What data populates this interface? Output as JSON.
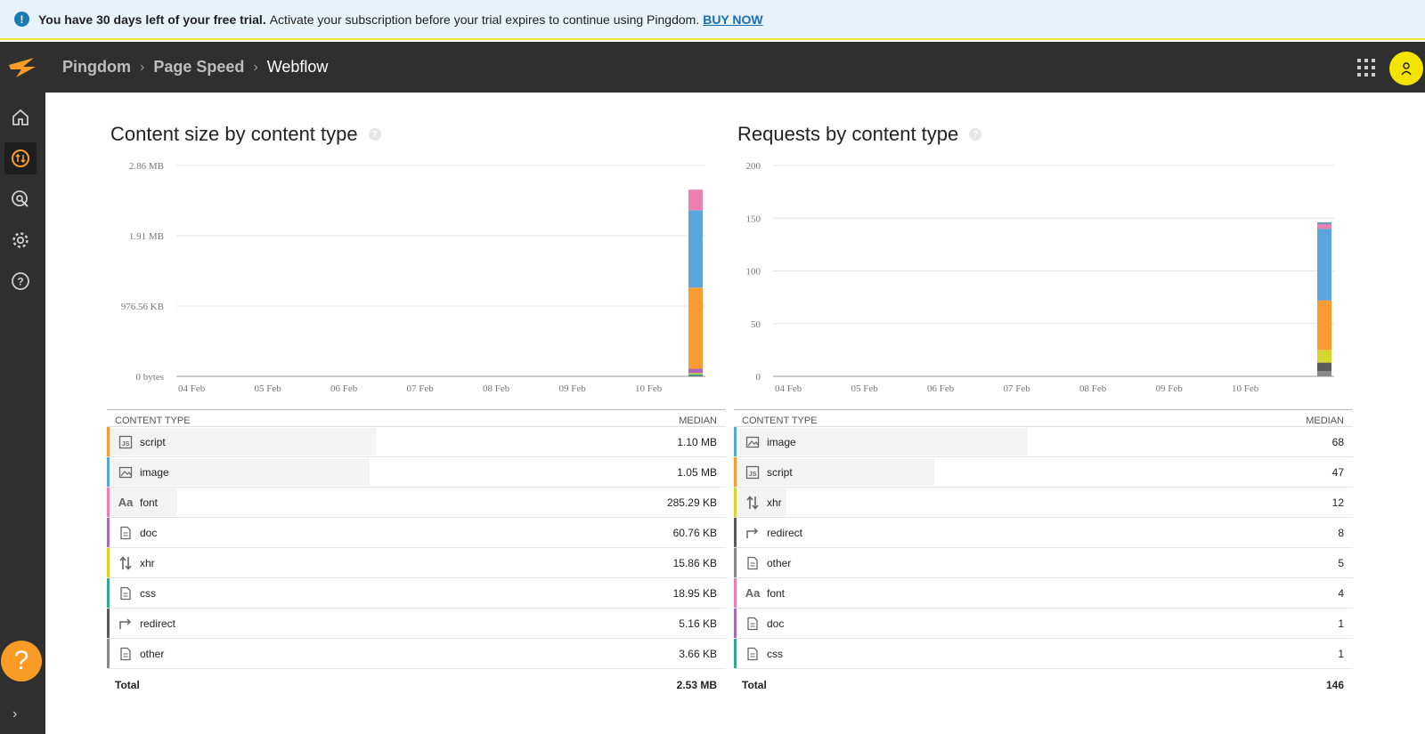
{
  "banner": {
    "bold_text": "You have 30 days left of your free trial.",
    "text": "Activate your subscription before your trial expires to continue using Pingdom.",
    "link": "BUY NOW"
  },
  "breadcrumb": [
    "Pingdom",
    "Page Speed",
    "Webflow"
  ],
  "colors": {
    "script": "#f99b32",
    "image": "#5aa5dc",
    "font": "#ec7fb0",
    "doc": "#a968b8",
    "xhr": "#d6d52f",
    "css": "#37a58e",
    "redirect": "#5b5b5b",
    "other": "#888888"
  },
  "chart_data": [
    {
      "type": "bar",
      "title": "Content size by content type",
      "x_ticks": [
        "04 Feb",
        "05 Feb",
        "06 Feb",
        "07 Feb",
        "08 Feb",
        "09 Feb",
        "10 Feb"
      ],
      "y_ticks": [
        "0 bytes",
        "976.56 KB",
        "1.91 MB",
        "2.86 MB"
      ],
      "ylim": [
        0,
        2.86
      ],
      "unit": "MB",
      "stacked": true,
      "series": [
        {
          "name": "other",
          "values": [
            0.004
          ]
        },
        {
          "name": "redirect",
          "values": [
            0.005
          ]
        },
        {
          "name": "css",
          "values": [
            0.019
          ]
        },
        {
          "name": "xhr",
          "values": [
            0.016
          ]
        },
        {
          "name": "doc",
          "values": [
            0.059
          ]
        },
        {
          "name": "script",
          "values": [
            1.1
          ]
        },
        {
          "name": "image",
          "values": [
            1.05
          ]
        },
        {
          "name": "font",
          "values": [
            0.279
          ]
        }
      ]
    },
    {
      "type": "bar",
      "title": "Requests by content type",
      "x_ticks": [
        "04 Feb",
        "05 Feb",
        "06 Feb",
        "07 Feb",
        "08 Feb",
        "09 Feb",
        "10 Feb"
      ],
      "y_ticks": [
        "0",
        "50",
        "100",
        "150",
        "200"
      ],
      "ylim": [
        0,
        200
      ],
      "stacked": true,
      "series": [
        {
          "name": "other",
          "values": [
            5
          ]
        },
        {
          "name": "redirect",
          "values": [
            8
          ]
        },
        {
          "name": "xhr",
          "values": [
            12
          ]
        },
        {
          "name": "script",
          "values": [
            47
          ]
        },
        {
          "name": "image",
          "values": [
            68
          ]
        },
        {
          "name": "font",
          "values": [
            4
          ]
        },
        {
          "name": "doc",
          "values": [
            1
          ]
        },
        {
          "name": "css",
          "values": [
            1
          ]
        }
      ]
    }
  ],
  "size_table": {
    "header_type": "CONTENT TYPE",
    "header_median": "MEDIAN",
    "rows": [
      {
        "name": "script",
        "value": "1.10 MB",
        "icon": "script-icon",
        "pct": 0.43
      },
      {
        "name": "image",
        "value": "1.05 MB",
        "icon": "image-icon",
        "pct": 0.42
      },
      {
        "name": "font",
        "value": "285.29 KB",
        "icon": "font-icon",
        "pct": 0.11
      },
      {
        "name": "doc",
        "value": "60.76 KB",
        "icon": "doc-icon",
        "pct": 0.0
      },
      {
        "name": "xhr",
        "value": "15.86 KB",
        "icon": "xhr-icon",
        "pct": 0.0
      },
      {
        "name": "css",
        "value": "18.95 KB",
        "icon": "doc-icon",
        "pct": 0.0
      },
      {
        "name": "redirect",
        "value": "5.16 KB",
        "icon": "redirect-icon",
        "pct": 0.0
      },
      {
        "name": "other",
        "value": "3.66 KB",
        "icon": "doc-icon",
        "pct": 0.0
      }
    ],
    "total_label": "Total",
    "total_value": "2.53 MB"
  },
  "requests_table": {
    "header_type": "CONTENT TYPE",
    "header_median": "MEDIAN",
    "rows": [
      {
        "name": "image",
        "value": "68",
        "icon": "image-icon",
        "pct": 0.47
      },
      {
        "name": "script",
        "value": "47",
        "icon": "script-icon",
        "pct": 0.32
      },
      {
        "name": "xhr",
        "value": "12",
        "icon": "xhr-icon",
        "pct": 0.08
      },
      {
        "name": "redirect",
        "value": "8",
        "icon": "redirect-icon",
        "pct": 0.0
      },
      {
        "name": "other",
        "value": "5",
        "icon": "doc-icon",
        "pct": 0.0
      },
      {
        "name": "font",
        "value": "4",
        "icon": "font-icon",
        "pct": 0.0
      },
      {
        "name": "doc",
        "value": "1",
        "icon": "doc-icon",
        "pct": 0.0
      },
      {
        "name": "css",
        "value": "1",
        "icon": "doc-icon",
        "pct": 0.0
      }
    ],
    "total_label": "Total",
    "total_value": "146"
  }
}
